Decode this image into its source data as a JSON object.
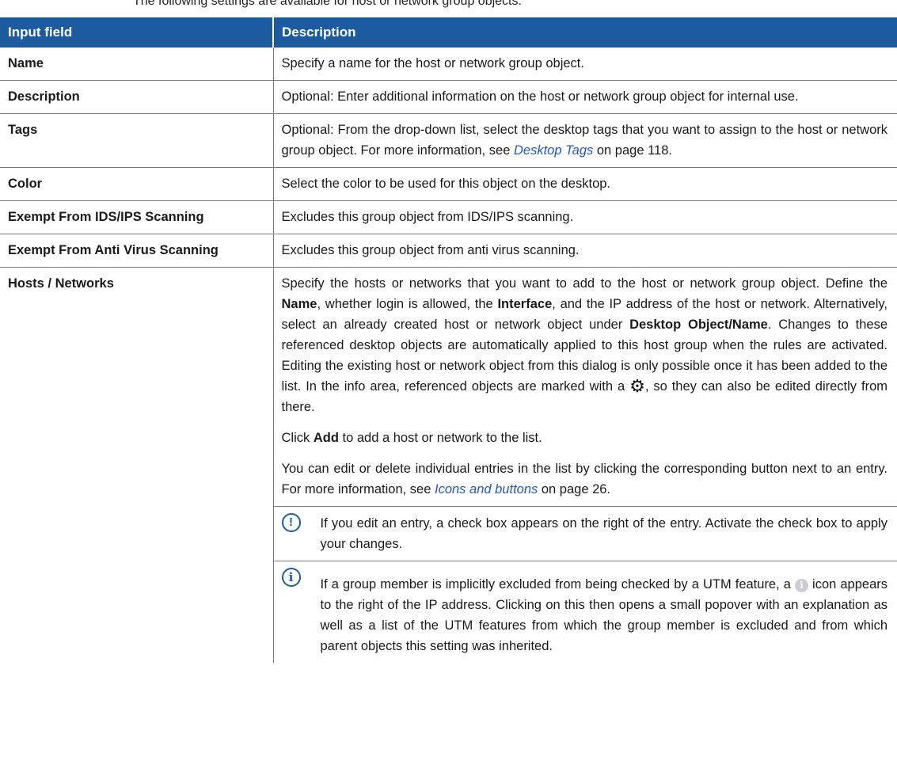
{
  "caption": "The following settings are available for host or network group objects:",
  "headers": {
    "field": "Input field",
    "description": "Description"
  },
  "rows": [
    {
      "field": "Name",
      "text": "Specify a name for the host or network group object."
    },
    {
      "field": "Description",
      "text": "Optional: Enter additional information on the host or network group object for internal use."
    },
    {
      "field": "Tags",
      "text_before": "Optional: From the drop-down list, select the desktop tags that you want to assign to the host or network group object. For more information, see ",
      "link": "Desktop Tags",
      "text_after": " on page 118."
    },
    {
      "field": "Color",
      "text": "Select the color to be used for this object on the desktop."
    },
    {
      "field": "Exempt From IDS/IPS Scanning",
      "text": "Excludes this group object from IDS/IPS scanning."
    },
    {
      "field": "Exempt From Anti Virus Scanning",
      "text": "Excludes this group object from anti virus scanning."
    }
  ],
  "hosts": {
    "field": "Hosts / Networks",
    "p1": {
      "a": "Specify the hosts or networks that you want to add to the host or network group object. Define the ",
      "b1": "Name",
      "c": ", whether login is allowed, the ",
      "b2": "Interface",
      "d": ", and the IP address of the host or network. Alternatively, select an already created host or network object under ",
      "b3": "Desktop Object/Name",
      "e": ". Changes to these referenced desktop objects are automatically applied to this host group when the rules are activated. Editing the existing host or network object from this dialog is only possible once it has been added to the list. In the info area, referenced objects are marked with a ",
      "icon": "gear-icon",
      "f": ", so they can also be edited directly from there."
    },
    "p2": {
      "a": "Click ",
      "b": "Add",
      "c": " to add a host or network to the list."
    },
    "p3": {
      "a": "You can edit or delete individual entries in the list by clicking the corresponding button next to an entry. For more information, see ",
      "link": "Icons and buttons",
      "b": " on page 26."
    },
    "note1": {
      "icon": "exclamation-icon",
      "text": "If you edit an entry, a check box appears on the right of the entry. Activate the check box to apply your changes."
    },
    "note2": {
      "icon": "info-icon",
      "a": "If a group member is implicitly excluded from being checked by a UTM feature, a ",
      "b": " icon appears to the right of the IP address. Clicking on this then opens a small popover with an explanation as well as a list of the UTM features from which the group member is excluded and from which parent objects this setting was inherited."
    }
  },
  "colors": {
    "header_bg": "#1d5b9f",
    "link": "#2156c9",
    "rule": "#7a7a7a"
  }
}
